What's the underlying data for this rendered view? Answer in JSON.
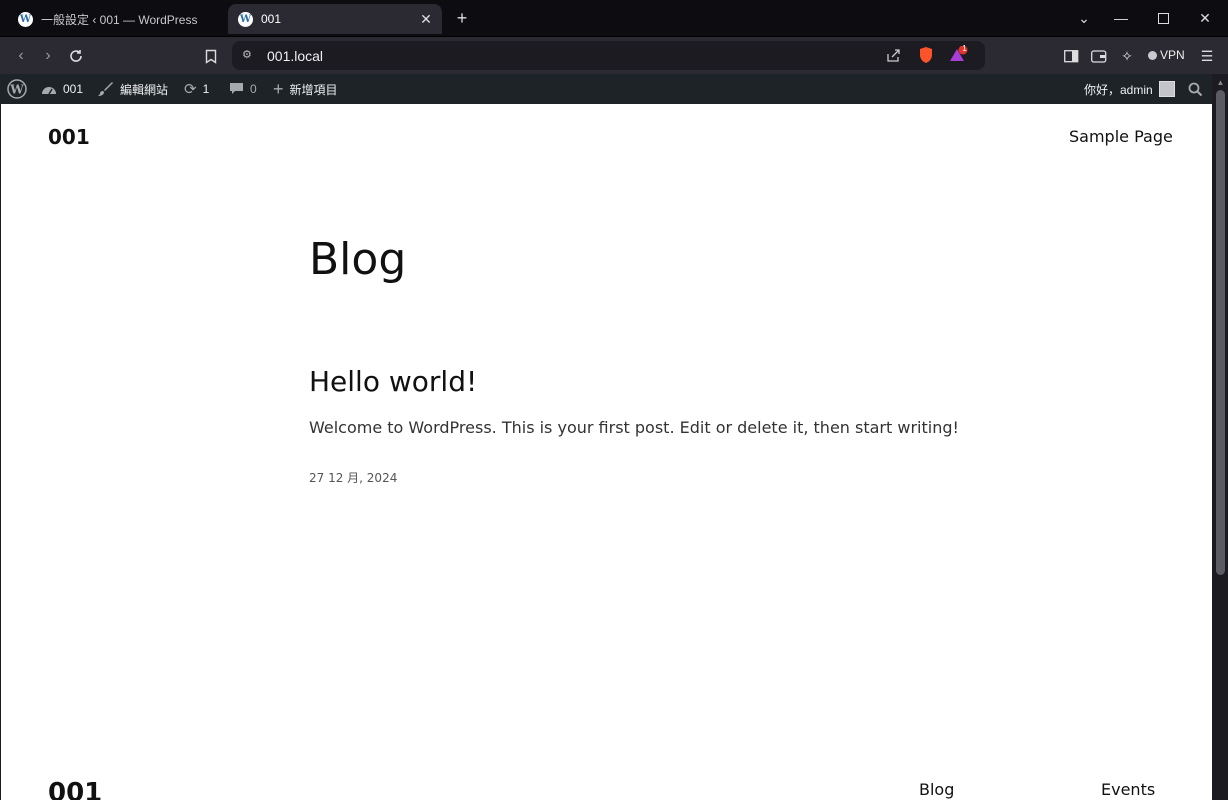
{
  "browser": {
    "tabs": [
      {
        "title": "一般設定 ‹ 001 — WordPress",
        "active": false
      },
      {
        "title": "001",
        "active": true
      }
    ],
    "url": "001.local",
    "vpn_label": "VPN",
    "notification_count": "1"
  },
  "adminbar": {
    "site_name": "001",
    "edit_site": "編輯網站",
    "updates_count": "1",
    "comments_count": "0",
    "new_item": "新增項目",
    "greeting": "你好，admin"
  },
  "page": {
    "site_title": "001",
    "nav": [
      "Sample Page"
    ],
    "heading": "Blog",
    "post": {
      "title": "Hello world!",
      "excerpt": "Welcome to WordPress. This is your first post. Edit or delete it, then start writing!",
      "date": "27 12 月, 2024"
    },
    "footer": {
      "site_title": "001",
      "links": [
        "Blog",
        "Events"
      ]
    }
  },
  "colors": {
    "admin_bar_bg": "#1d2327",
    "tab_strip_bg": "#0d0d11",
    "toolbar_bg": "#2b2a33",
    "brave_orange": "#fb542b"
  },
  "icons": [
    "wordpress-icon",
    "dashboard-icon",
    "brush-icon",
    "updates-icon",
    "comment-icon",
    "plus-icon",
    "search-icon",
    "bookmark-icon",
    "share-icon",
    "brave-shield-icon",
    "brave-rewards-icon",
    "sidebar-icon",
    "wallet-icon",
    "leo-ai-icon",
    "menu-icon"
  ]
}
